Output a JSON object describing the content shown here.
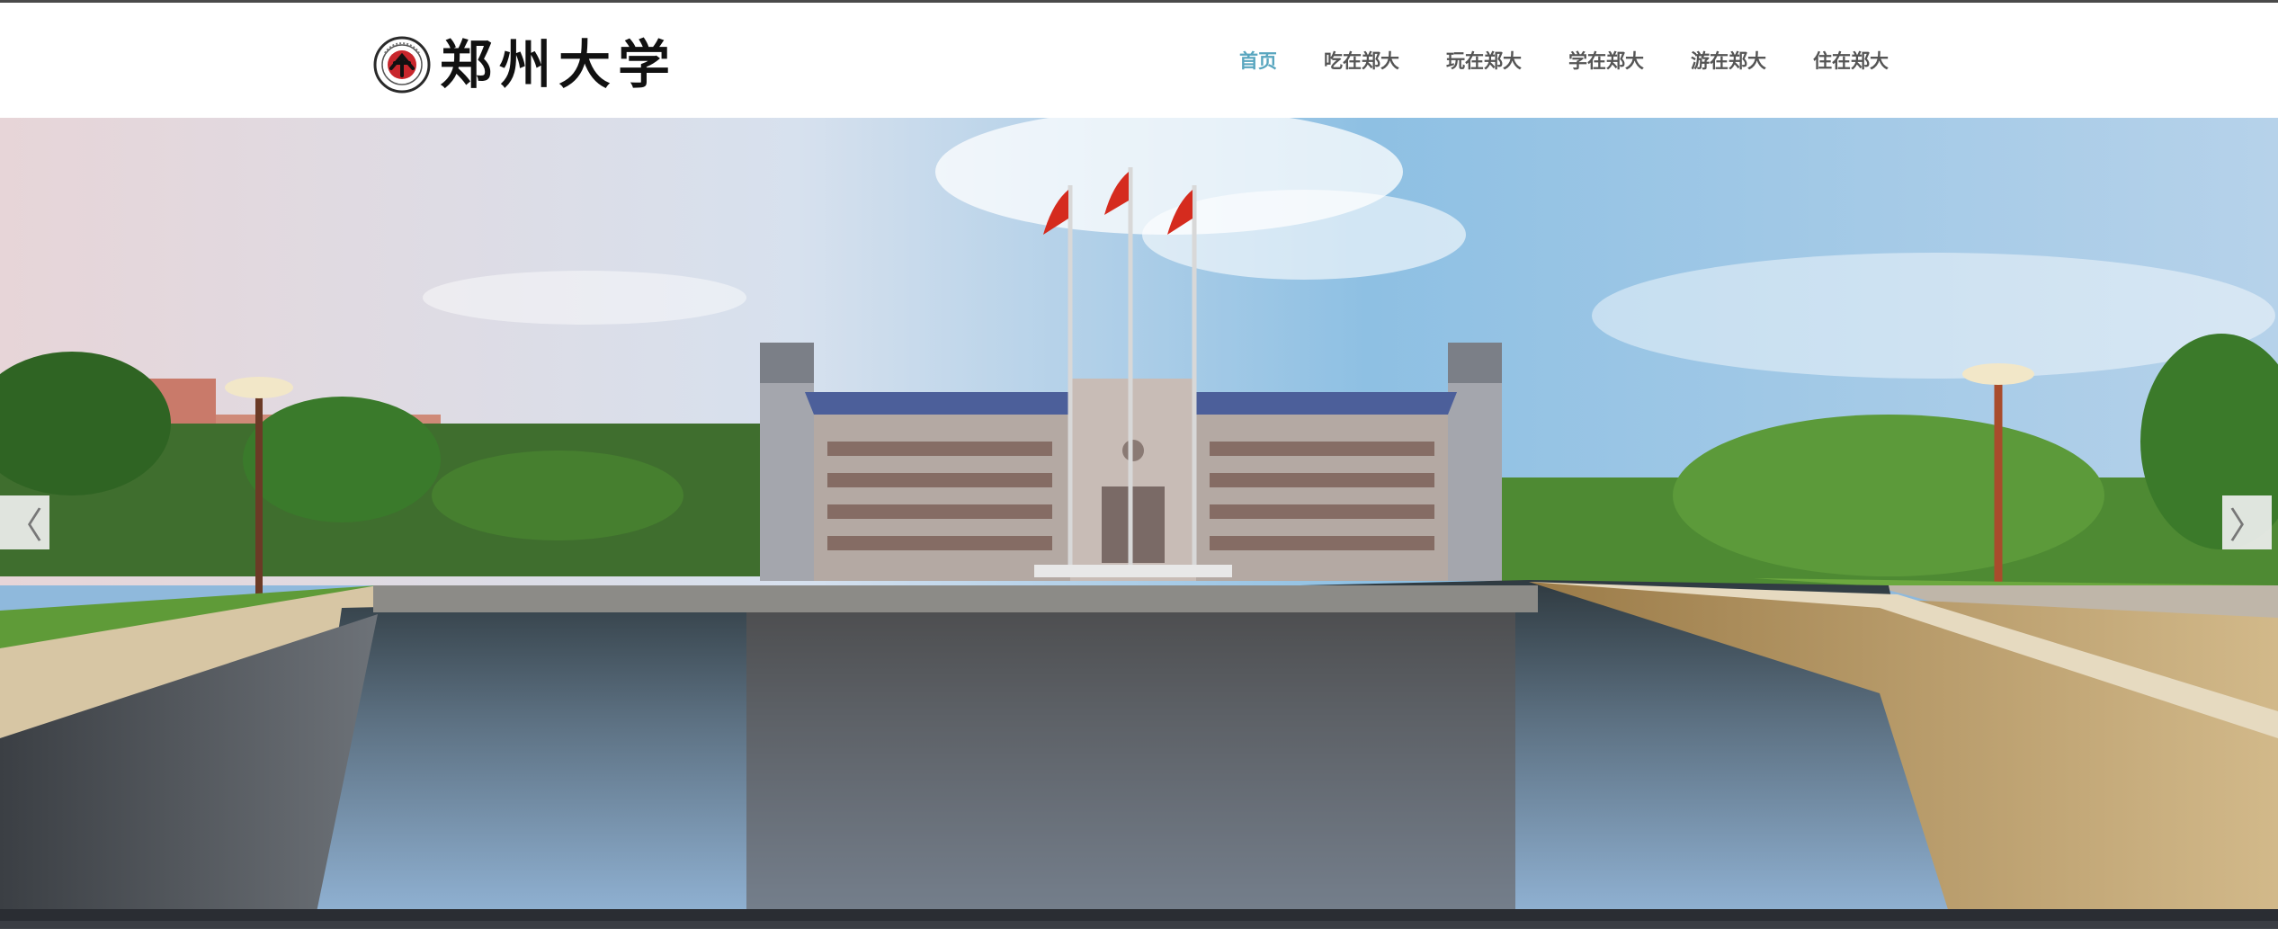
{
  "brand": {
    "name": "郑州大学",
    "logo_icon": "zzu-seal-icon"
  },
  "nav": {
    "items": [
      {
        "label": "首页",
        "active": true
      },
      {
        "label": "吃在郑大",
        "active": false
      },
      {
        "label": "玩在郑大",
        "active": false
      },
      {
        "label": "学在郑大",
        "active": false
      },
      {
        "label": "游在郑大",
        "active": false
      },
      {
        "label": "住在郑大",
        "active": false
      }
    ],
    "active_color": "#59a6bf",
    "text_color": "#555555"
  },
  "slider": {
    "prev_icon": "chevron-left-icon",
    "next_icon": "chevron-right-icon",
    "prev_glyph": "〈",
    "next_glyph": "〉",
    "image": "campus-main-building-photo"
  }
}
